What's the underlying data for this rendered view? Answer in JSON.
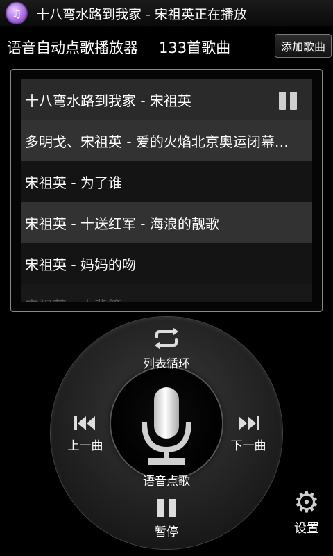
{
  "status": {
    "icon": "music-note-icon",
    "text": "十八弯水路到我家 - 宋祖英正在播放"
  },
  "header": {
    "title": "语音自动点歌播放器",
    "count": "133首歌曲",
    "add_label": "添加歌曲"
  },
  "playlist": [
    {
      "title": "十八弯水路到我家 - 宋祖英",
      "playing": true
    },
    {
      "title": "多明戈、宋祖英 - 爱的火焰北京奥运闭幕…",
      "playing": false
    },
    {
      "title": "宋祖英 - 为了谁",
      "playing": false
    },
    {
      "title": "宋祖英 - 十送红军 - 海浪的靓歌",
      "playing": false
    },
    {
      "title": "宋祖英 - 妈妈的吻",
      "playing": false
    },
    {
      "title": "宋祖英 - 小背篓",
      "playing": false
    }
  ],
  "controls": {
    "loop_label": "列表循环",
    "prev_label": "上一曲",
    "next_label": "下一曲",
    "voice_label": "语音点歌",
    "pause_label": "暂停",
    "settings_label": "设置"
  },
  "colors": {
    "accent": "#a25ee0",
    "background": "#000000"
  }
}
